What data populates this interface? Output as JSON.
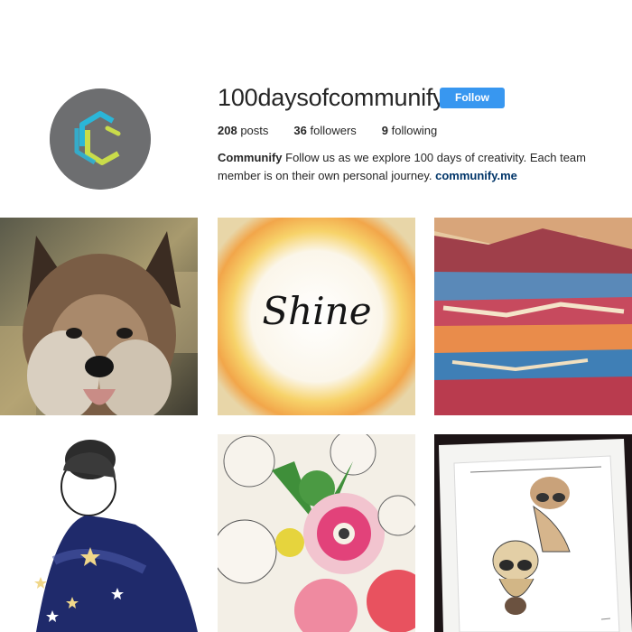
{
  "profile": {
    "username": "100daysofcommunify",
    "follow_label": "Follow",
    "posts_count": "208",
    "posts_label": "posts",
    "followers_count": "36",
    "followers_label": "followers",
    "following_count": "9",
    "following_label": "following",
    "bio_name": "Communify",
    "bio_text": "Follow us as we explore 100 days of creativity. Each team member is on their own personal journey.",
    "bio_link": "communify.me"
  },
  "colors": {
    "follow_button": "#3897f0",
    "avatar_bg": "#6d6e70",
    "logo_cyan": "#2bb6d8",
    "logo_lime": "#c9dc4a",
    "link": "#003569"
  },
  "posts": [
    {
      "subject": "painted-dog"
    },
    {
      "subject": "shine-watercolor",
      "text": "Shine"
    },
    {
      "subject": "abstract-landscape"
    },
    {
      "subject": "woman-starry-cape"
    },
    {
      "subject": "flowers-illustration"
    },
    {
      "subject": "framed-dog-drawing"
    }
  ]
}
